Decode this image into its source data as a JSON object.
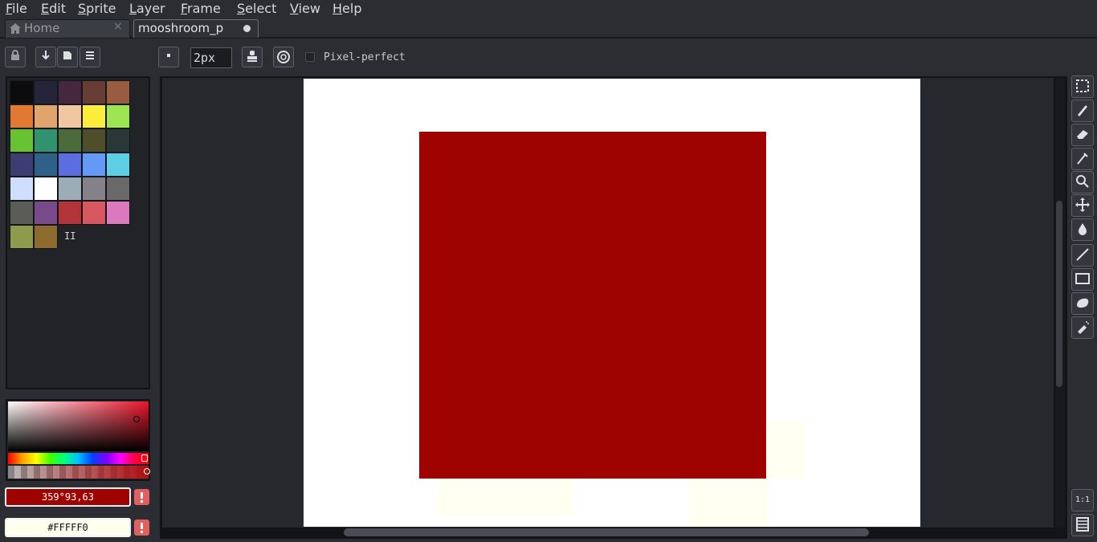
{
  "menu": [
    "File",
    "Edit",
    "Sprite",
    "Layer",
    "Frame",
    "Select",
    "View",
    "Help"
  ],
  "tabs": {
    "home": {
      "label": "Home"
    },
    "active": {
      "label": "mooshroom_p"
    }
  },
  "brush": {
    "size": "2px"
  },
  "options": {
    "pixel_perfect_label": "Pixel-perfect"
  },
  "palette": {
    "colors": [
      "#0c0c0f",
      "#25243a",
      "#46283e",
      "#673d36",
      "#985c40",
      "#e17a30",
      "#e0a46c",
      "#f0c7a0",
      "#fbee3a",
      "#9ce550",
      "#67c332",
      "#30936d",
      "#4a6b3a",
      "#4f4e2a",
      "#2b3837",
      "#3e3d72",
      "#2f6087",
      "#5a6ee2",
      "#649af5",
      "#5ccfe4",
      "#cfdefd",
      "#ffffff",
      "#9cadb7",
      "#858188",
      "#686968",
      "#5b5b58",
      "#794a8a",
      "#b33539",
      "#d95761",
      "#db79bd",
      "#8e9b4c",
      "#8d6b2f"
    ],
    "pause_glyph": "II"
  },
  "colors": {
    "foreground_text": "359°93,63",
    "foreground_hex": "#9e0300",
    "background_text": "#FFFFF0",
    "background_hex": "#fffff0"
  },
  "canvas": {
    "background": "#ffffff",
    "shape_color": "#9e0300"
  },
  "tools": [
    "rectangular-marquee",
    "pencil",
    "eraser",
    "eyedropper",
    "zoom",
    "move",
    "paint-bucket",
    "line",
    "rectangle",
    "blob",
    "spray"
  ],
  "bottom_right": {
    "zoom_label": "1:1"
  }
}
